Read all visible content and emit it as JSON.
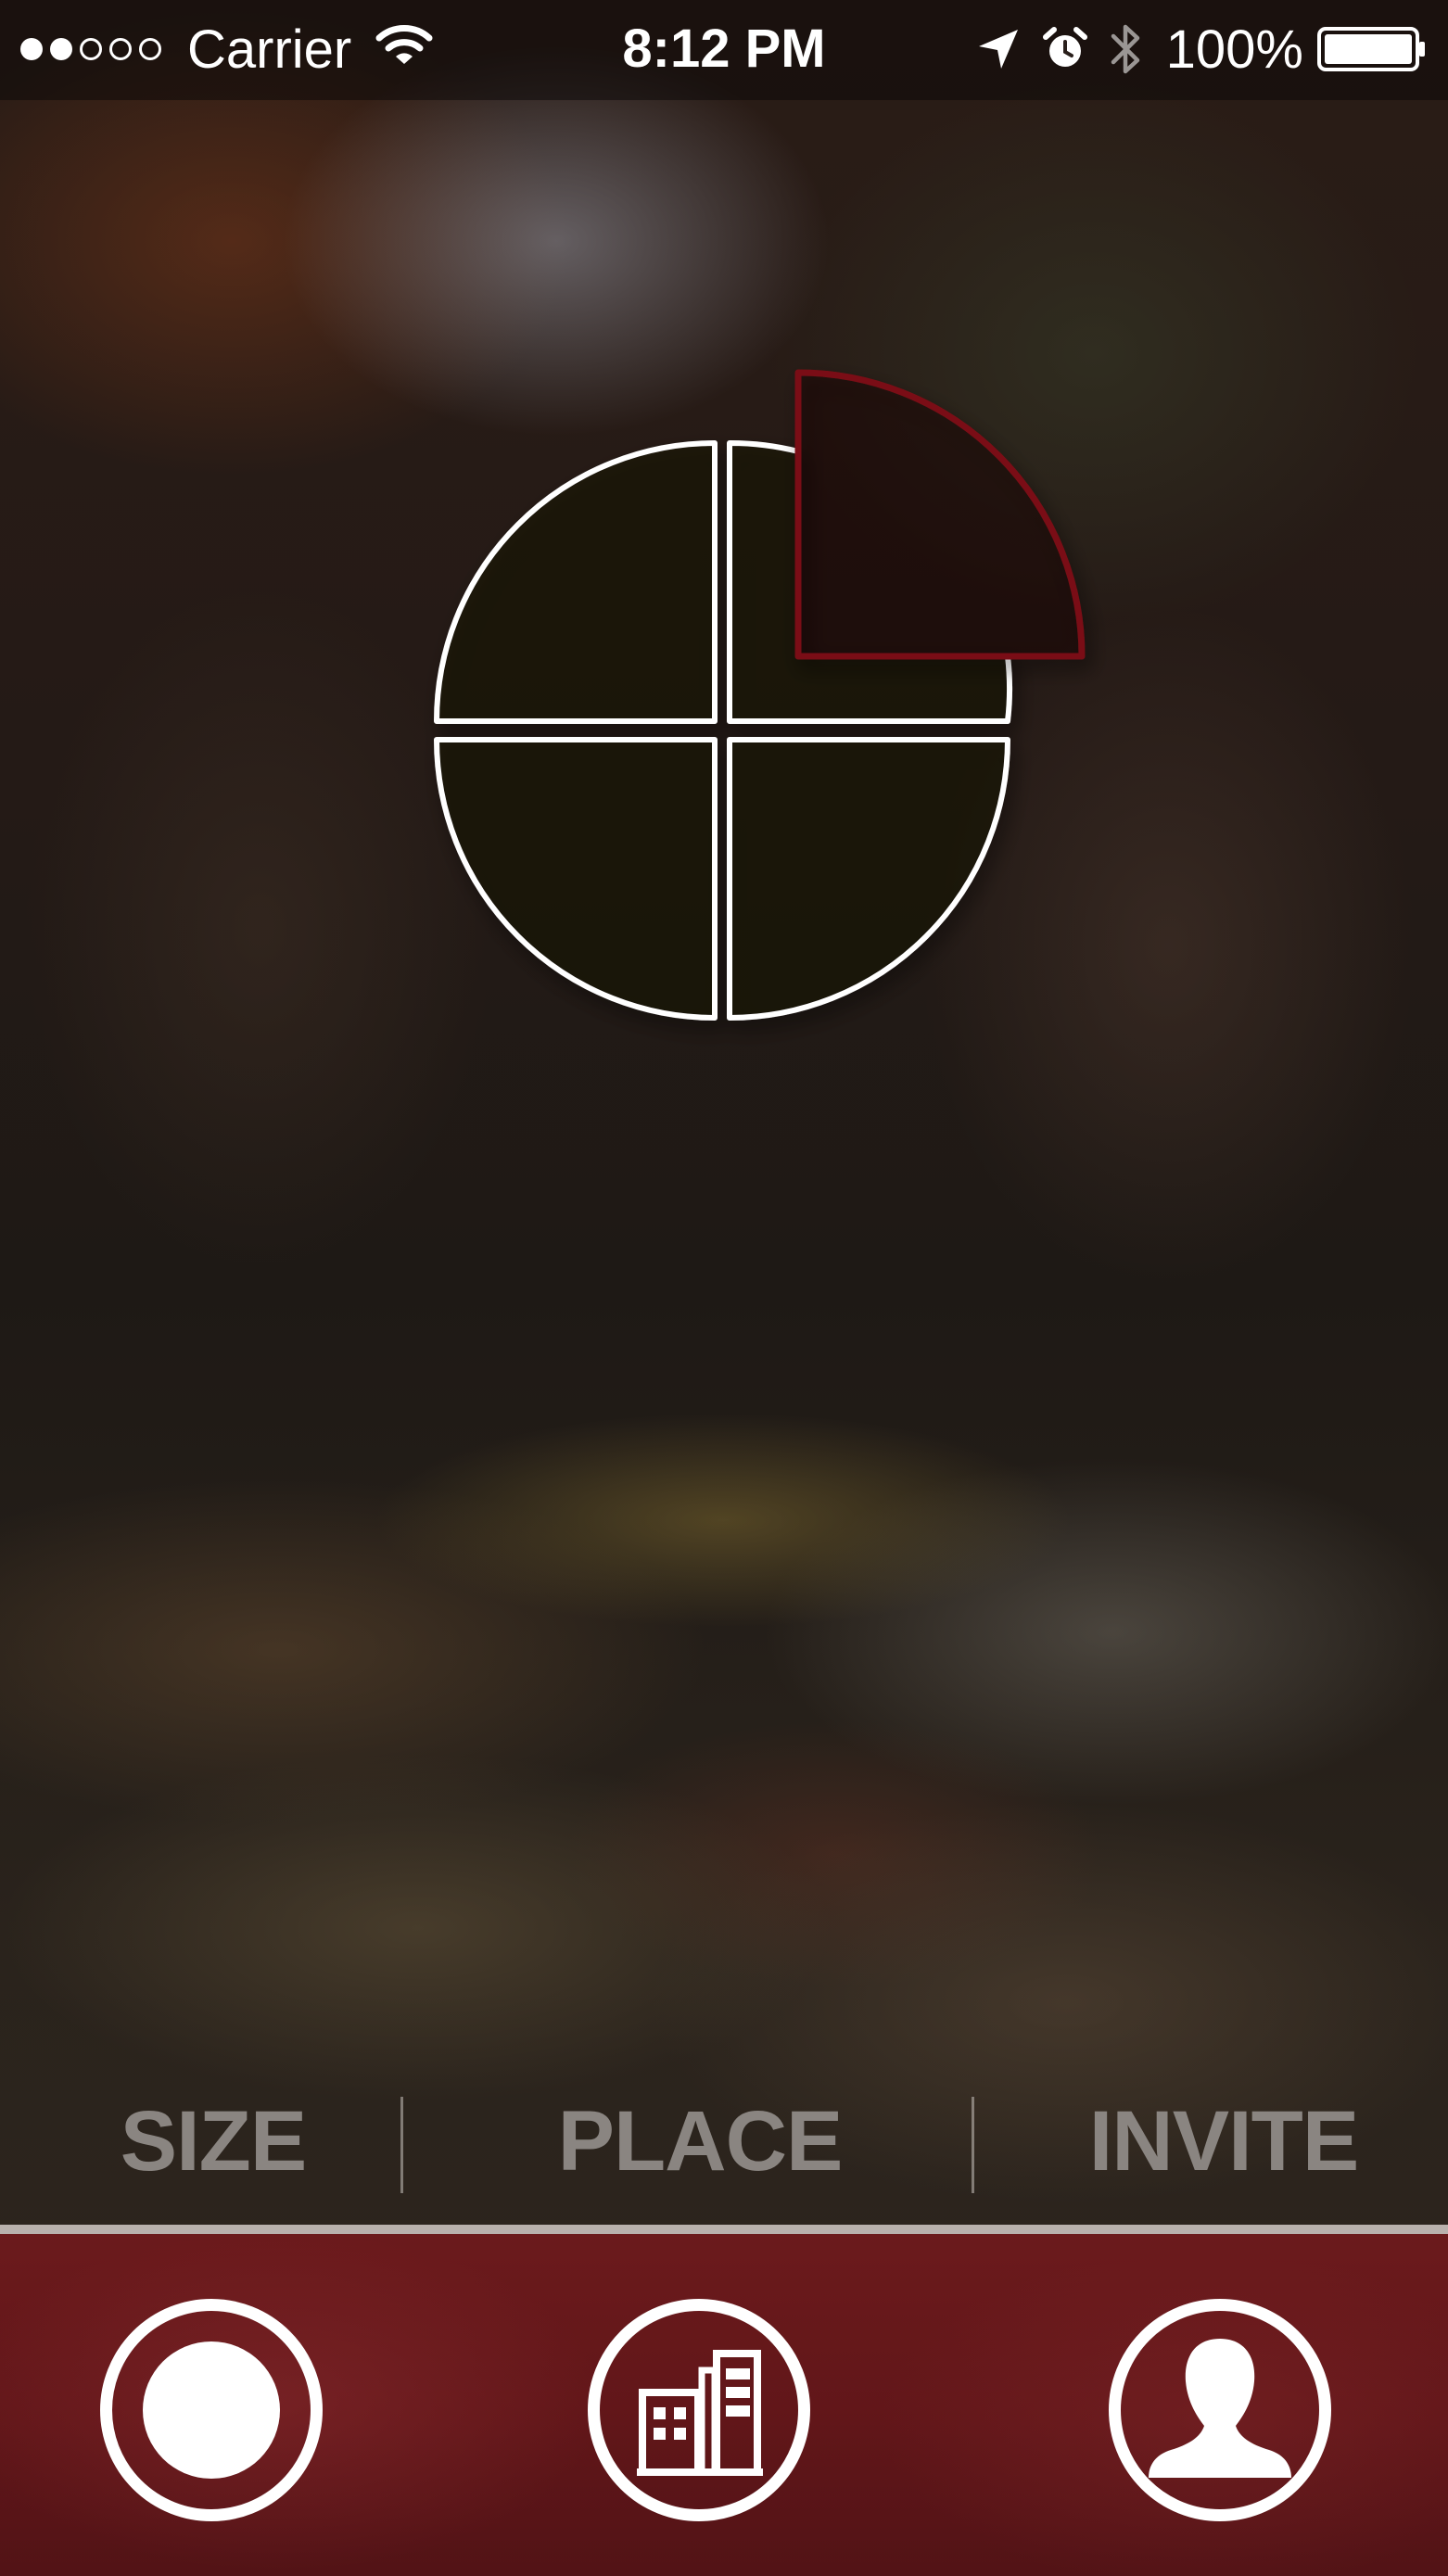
{
  "status_bar": {
    "signal": {
      "filled": 2,
      "total": 5
    },
    "carrier": "Carrier",
    "time": "8:12 PM",
    "battery_percent": "100%",
    "battery_level": 1.0,
    "icons": [
      "wifi-icon",
      "location-arrow-icon",
      "alarm-clock-icon",
      "bluetooth-icon",
      "battery-icon"
    ]
  },
  "logo": {
    "name": "pie-quarters-logo",
    "outline_color": "#ffffff",
    "highlight_color": "#7a1014"
  },
  "steps": {
    "size": "SIZE",
    "place": "PLACE",
    "invite": "INVITE"
  },
  "tab_bar": {
    "accent_color": "#6b1a1c",
    "tabs": [
      {
        "id": "size",
        "icon": "size-circle-icon"
      },
      {
        "id": "place",
        "icon": "buildings-icon"
      },
      {
        "id": "invite",
        "icon": "person-icon"
      }
    ]
  }
}
